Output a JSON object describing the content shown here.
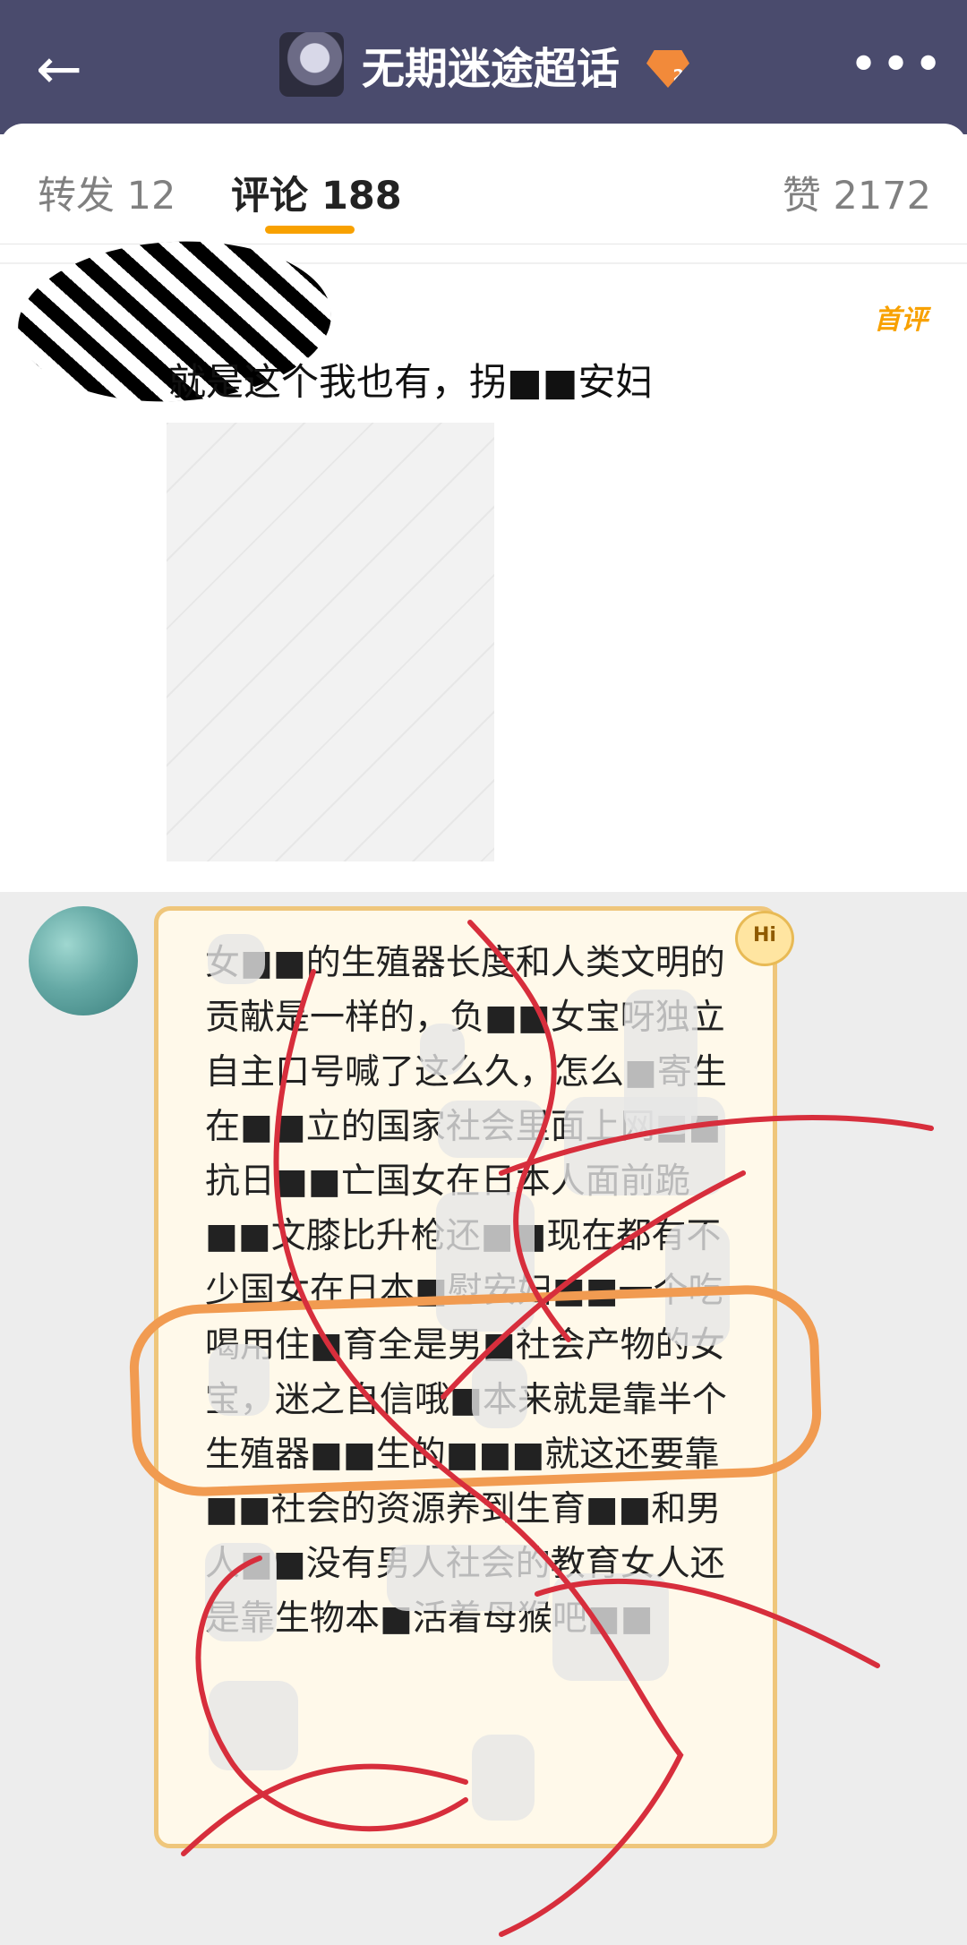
{
  "header": {
    "back_icon": "arrow-left-icon",
    "title": "无期迷途超话",
    "badge_icon": "level-badge-icon",
    "badge_level": "2",
    "more_icon": "more-horizontal-icon"
  },
  "tabs": {
    "forward": "转发 12",
    "comment": "评论 188",
    "like": "赞 2172"
  },
  "first_comment": {
    "tag": "首评",
    "text": "就是这个我也有，拐■■安妇"
  },
  "reply_bubble": {
    "hi_label": "Hi",
    "text": "女■■的生殖器长度和人类文明的贡献是一样的，负■■女宝呀独立自主口号喊了这么久，怎么■寄生在■■立的国家社会里面上网■■抗日■■亡国女在日本人面前跪■■文膝比升枪还■■现在都有不少国女在日本■慰安妇■■一个吃喝用住■育全是男■社会产物的女宝，迷之自信哦■本来就是靠半个生殖器■■生的■■■就这还要靠■■社会的资源养到生育■■和男人■■没有男人社会的教育女人还是靠生物本■活着母猴吧■■"
  }
}
